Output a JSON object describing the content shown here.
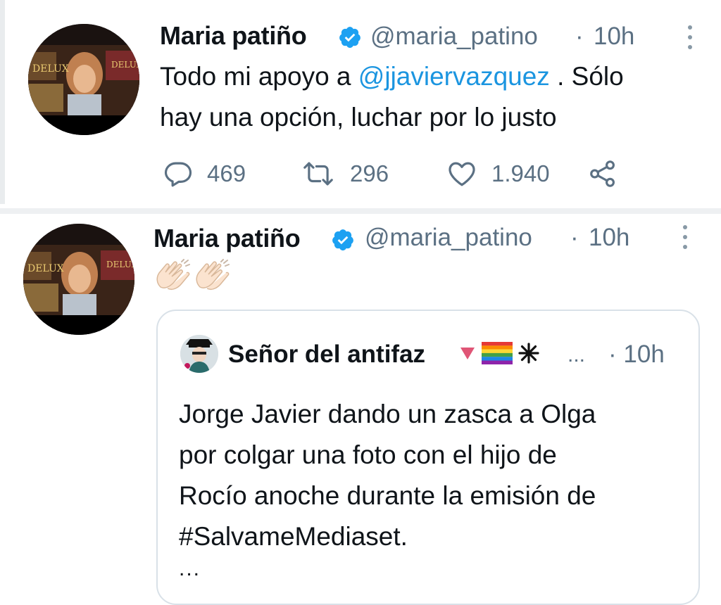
{
  "tweet1": {
    "author_name": "Maria patiño",
    "handle": "@maria_patino",
    "separator": "·",
    "time": "10h",
    "text_line1_before": "Todo mi apoyo a ",
    "mention": "@jjaviervazquez",
    "text_line1_after": " . Sólo",
    "text_line2": "hay una opción, luchar por lo justo",
    "replies": "469",
    "retweets": "296",
    "likes": "1.940"
  },
  "tweet2": {
    "author_name": "Maria patiño",
    "handle": "@maria_patino",
    "separator": "·",
    "time": "10h",
    "emoji": "👏🏻👏🏻",
    "quote": {
      "author_name": "Señor del antifaz",
      "truncation": "...",
      "separator": "·",
      "time": "10h",
      "text_lines": [
        "Jorge Javier dando un zasca a Olga",
        "por colgar una foto con el hijo de",
        "Rocío anoche durante la emisión de",
        "#SalvameMediaset."
      ],
      "more": "..."
    }
  },
  "colors": {
    "link": "#1b95e0",
    "verified": "#1da1f2",
    "secondary_text": "#5b7083",
    "primary_text": "#0f1419"
  },
  "icons": [
    "verified-badge-icon",
    "more-vertical-icon",
    "reply-icon",
    "retweet-icon",
    "like-icon",
    "share-icon",
    "clap-emoji",
    "heart-emoji",
    "rainbow-flag-emoji",
    "sparkle-emoji"
  ]
}
